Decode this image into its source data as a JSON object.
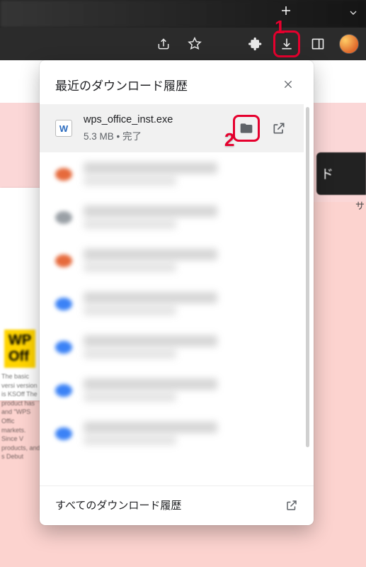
{
  "annotations": {
    "marker1": "1",
    "marker2": "2"
  },
  "toolbar": {
    "share_icon": "share-icon",
    "star_icon": "star-icon",
    "extensions_icon": "extensions-icon",
    "downloads_icon": "downloads-icon",
    "sidepanel_icon": "sidepanel-icon",
    "avatar_icon": "avatar"
  },
  "downloads_popup": {
    "title": "最近のダウンロード履歴",
    "items": [
      {
        "icon_label": "W",
        "name": "wps_office_inst.exe",
        "size": "5.3 MB",
        "status": "完了",
        "blurred": false,
        "dot_color": "#2b6bbf"
      },
      {
        "blurred": true,
        "dot_color": "#e66a3c"
      },
      {
        "blurred": true,
        "dot_color": "#9aa0a6"
      },
      {
        "blurred": true,
        "dot_color": "#e66a3c"
      },
      {
        "blurred": true,
        "dot_color": "#3b82f6"
      },
      {
        "blurred": true,
        "dot_color": "#3b82f6"
      },
      {
        "blurred": true,
        "dot_color": "#3b82f6"
      },
      {
        "blurred": true,
        "dot_color": "#3b82f6"
      }
    ],
    "footer_label": "すべてのダウンロード履歴"
  },
  "page_bg": {
    "wps_sticker_line1": "WP",
    "wps_sticker_line2": "Off",
    "side_blurb": "The basic versi version is KSOff The product has and \"WPS Offic markets. Since V products, and s Debut",
    "right_button_label": "ド",
    "right_small_label": "サ"
  }
}
